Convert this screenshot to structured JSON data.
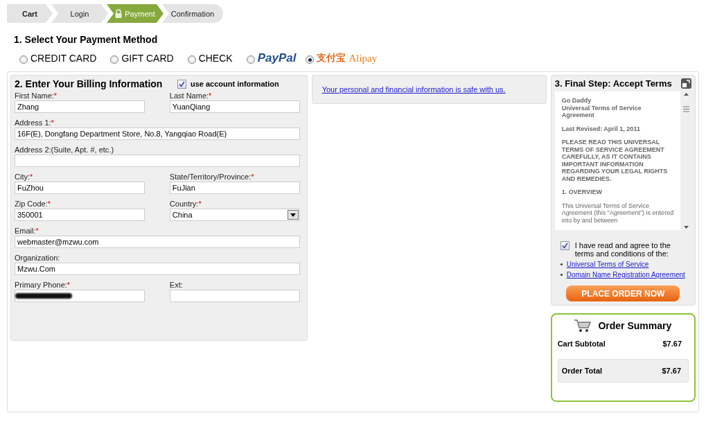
{
  "steps": [
    {
      "label": "Cart",
      "selected": false,
      "locked": false
    },
    {
      "label": "Login",
      "selected": false,
      "locked": false
    },
    {
      "label": "Payment",
      "selected": true,
      "locked": true
    },
    {
      "label": "Confirmation",
      "selected": false,
      "locked": false
    }
  ],
  "payment": {
    "title": "1. Select Your Payment Method",
    "methods": [
      {
        "kind": "text",
        "label": "CREDIT CARD",
        "selected": false
      },
      {
        "kind": "text",
        "label": "GIFT CARD",
        "selected": false
      },
      {
        "kind": "text",
        "label": "CHECK",
        "selected": false
      },
      {
        "kind": "paypal",
        "label": "PayPal",
        "selected": false
      },
      {
        "kind": "alipay",
        "label": "支付宝",
        "label_2": "Alipay",
        "selected": true
      }
    ]
  },
  "billing": {
    "title": "2. Enter Your Billing Information",
    "use_account": {
      "label": "use account information",
      "checked": true
    },
    "rows": [
      [
        {
          "label": "First Name:",
          "required_mark": "*",
          "kind": "text",
          "value": "Zhang"
        },
        {
          "label": "Last Name:",
          "required_mark": "*",
          "kind": "text",
          "value": "YuanQiang"
        }
      ],
      [
        {
          "label": "Address 1:",
          "required_mark": "*",
          "kind": "text",
          "value": "16F(E), Dongfang Department Store, No.8, Yangqiao Road(E)"
        }
      ],
      [
        {
          "label": "Address 2:(Suite, Apt. #, etc.)",
          "kind": "text"
        }
      ],
      [
        {
          "label": "City:",
          "required_mark": "*",
          "kind": "text",
          "value": "FuZhou"
        },
        {
          "label": "State/Territory/Province:",
          "required_mark": "*",
          "kind": "text",
          "value": "FuJian"
        }
      ],
      [
        {
          "label": "Zip Code:",
          "required_mark": "*",
          "kind": "text",
          "value": "350001"
        },
        {
          "label": "Country:",
          "required_mark": "*",
          "kind": "select",
          "value": "China"
        }
      ],
      [
        {
          "label": "Email:",
          "required_mark": "*",
          "kind": "text",
          "value": "webmaster@mzwu.com"
        }
      ],
      [
        {
          "label": "Organization:",
          "kind": "text",
          "value": "Mzwu.Com"
        }
      ],
      [
        {
          "label": "Primary Phone:",
          "required_mark": "*",
          "kind": "redacted"
        },
        {
          "label": "Ext:",
          "kind": "text"
        }
      ]
    ]
  },
  "secure_link": "Your personal and financial information is safe with us.",
  "terms": {
    "title": "3. Final Step: Accept Terms",
    "paragraphs": [
      {
        "kind": "bold",
        "lines": [
          "Go Daddy",
          "Universal Terms of Service",
          "Agreement"
        ]
      },
      {
        "kind": "bold",
        "lines": [
          "Last Revised: April 1, 2011"
        ]
      },
      {
        "kind": "bold",
        "lines": [
          "PLEASE READ THIS UNIVERSAL TERMS OF SERVICE AGREEMENT CAREFULLY, AS IT CONTAINS IMPORTANT INFORMATION REGARDING YOUR LEGAL RIGHTS AND REMEDIES."
        ]
      },
      {
        "kind": "bold",
        "lines": [
          "1. OVERVIEW"
        ]
      },
      {
        "kind": "plain",
        "lines": [
          "This Universal Terms of Service Agreement (this \"Agreement\") is entered into by and between"
        ]
      }
    ],
    "agree": {
      "label": "I have read and agree to the terms and conditions of the:",
      "checked": true
    },
    "links": [
      "Universal Terms of Service",
      "Domain Name Registration Agreement"
    ],
    "button": "PLACE ORDER NOW"
  },
  "summary": {
    "title": "Order Summary",
    "rows": [
      {
        "label": "Cart Subtotal",
        "value": "$7.67",
        "kind": "plain"
      },
      {
        "label": "Order Total",
        "value": "$7.67",
        "kind": "total"
      }
    ]
  }
}
